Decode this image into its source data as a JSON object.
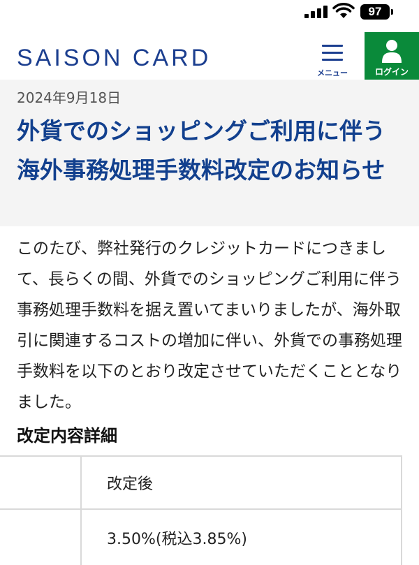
{
  "status_bar": {
    "battery": "97"
  },
  "header": {
    "logo": "SAISON CARD",
    "menu_label": "メニュー",
    "login_label": "ログイン",
    "brand_color": "#1b3e8f",
    "login_color": "#0a8a3a"
  },
  "article": {
    "date": "2024年9月18日",
    "title": "外貨でのショッピングご利用に伴う海外事務処理手数料改定のお知らせ",
    "body": "このたび、弊社発行のクレジットカードにつきまして、長らくの間、外貨でのショッピングご利用に伴う事務処理手数料を据え置いてまいりましたが、海外取引に関連するコストの増加に伴い、外貨での事務処理手数料を以下のとおり改定させていただくこととなりました。",
    "section_heading": "改定内容詳細",
    "table": {
      "header": "改定後",
      "value": "3.50%(税込3.85%)"
    }
  },
  "icons": [
    "signal-icon",
    "wifi-icon",
    "battery-icon",
    "menu-icon",
    "user-icon"
  ]
}
